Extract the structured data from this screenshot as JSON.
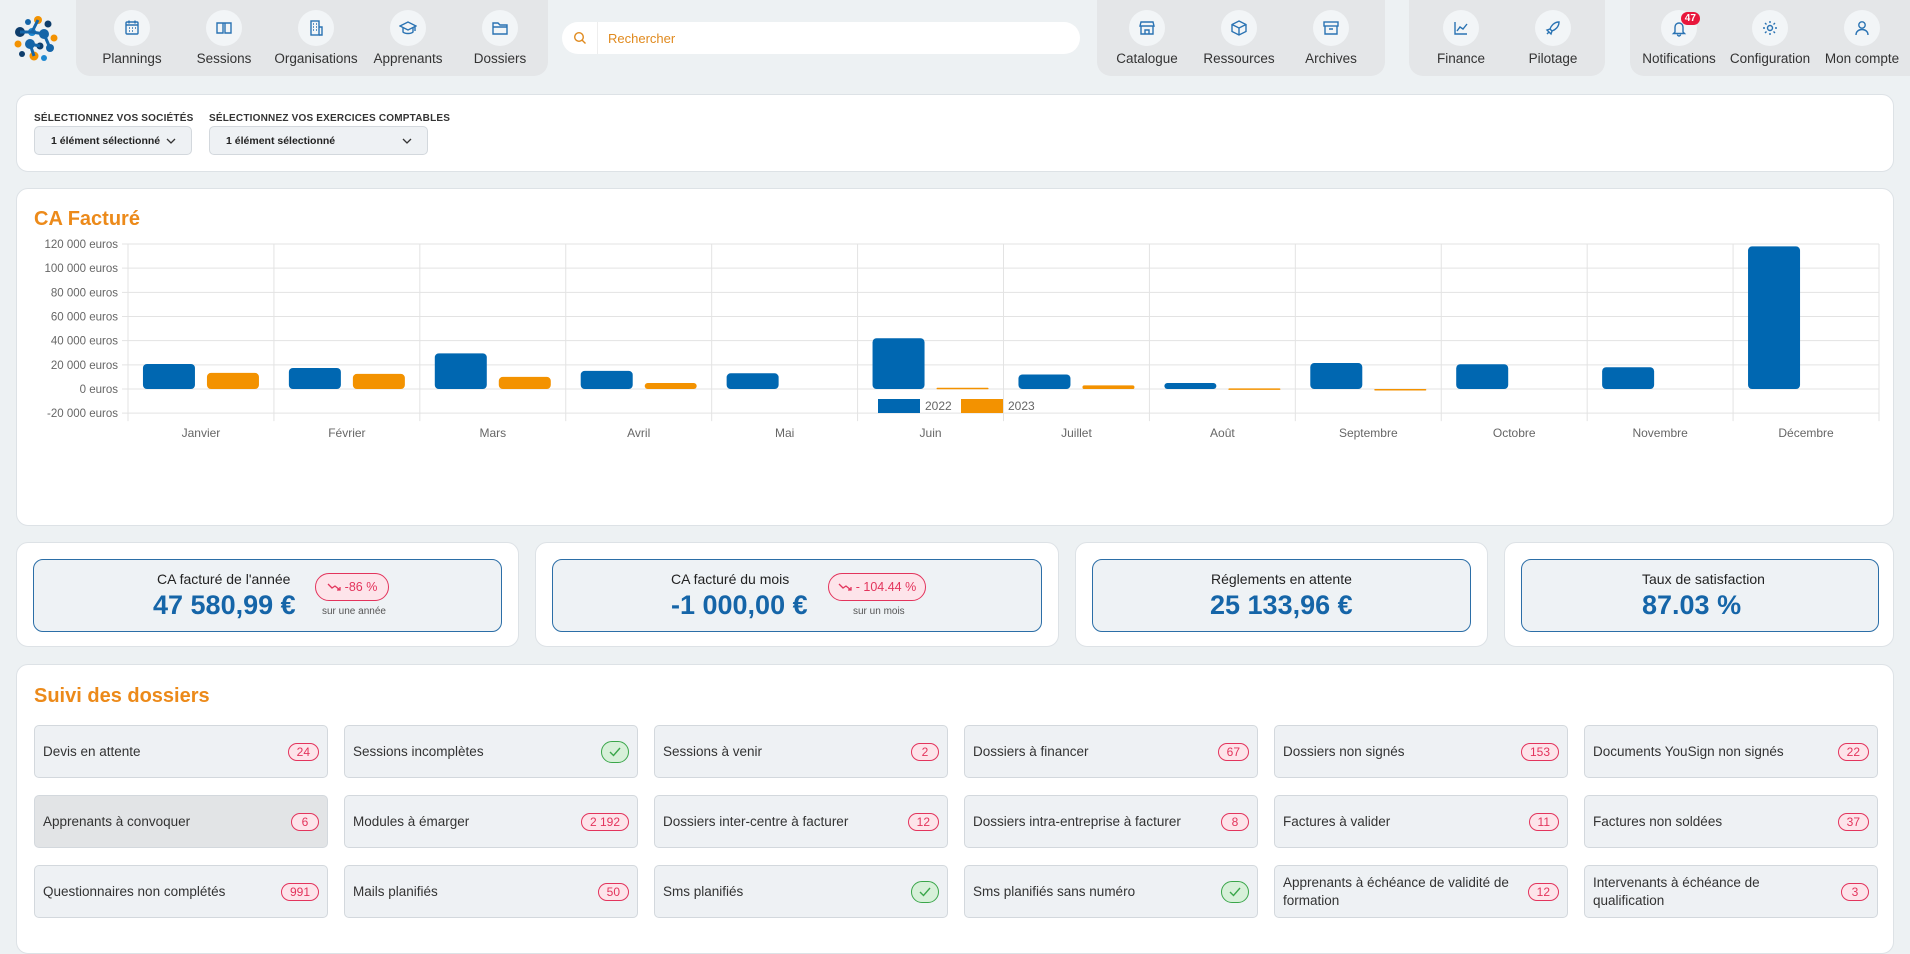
{
  "nav": {
    "group1": [
      {
        "label": "Plannings",
        "icon": "calendar-icon"
      },
      {
        "label": "Sessions",
        "icon": "book-icon"
      },
      {
        "label": "Organisations",
        "icon": "building-icon"
      },
      {
        "label": "Apprenants",
        "icon": "graduation-cap-icon"
      },
      {
        "label": "Dossiers",
        "icon": "folder-icon"
      }
    ],
    "search_placeholder": "Rechercher",
    "group2": [
      {
        "label": "Catalogue",
        "icon": "store-icon"
      },
      {
        "label": "Ressources",
        "icon": "box-icon"
      },
      {
        "label": "Archives",
        "icon": "archive-icon"
      }
    ],
    "group3": [
      {
        "label": "Finance",
        "icon": "line-chart-icon"
      },
      {
        "label": "Pilotage",
        "icon": "rocket-icon"
      }
    ],
    "group4": [
      {
        "label": "Notifications",
        "icon": "bell-icon",
        "badge": "47"
      },
      {
        "label": "Configuration",
        "icon": "gear-icon"
      },
      {
        "label": "Mon compte",
        "icon": "user-icon"
      }
    ]
  },
  "filters": {
    "societes_label": "SÉLECTIONNEZ VOS SOCIÉTÉS",
    "societes_value": "1 élément sélectionné",
    "exercices_label": "SÉLECTIONNEZ VOS EXERCICES COMPTABLES",
    "exercices_value": "1 élément sélectionné"
  },
  "chart_data": {
    "type": "bar",
    "title": "CA Facturé",
    "xlabel": "",
    "ylabel": "",
    "categories": [
      "Janvier",
      "Février",
      "Mars",
      "Avril",
      "Mai",
      "Juin",
      "Juillet",
      "Août",
      "Septembre",
      "Octobre",
      "Novembre",
      "Décembre"
    ],
    "series": [
      {
        "name": "2022",
        "color": "#0067b1",
        "values": [
          20700,
          17400,
          29500,
          15000,
          13000,
          42000,
          12000,
          5000,
          21500,
          20500,
          18000,
          118000
        ]
      },
      {
        "name": "2023",
        "color": "#f39200",
        "values": [
          13300,
          12500,
          10000,
          5000,
          0,
          1000,
          3000,
          500,
          -1000,
          0,
          0,
          0
        ]
      }
    ],
    "ylim": [
      -20000,
      120000
    ],
    "yticks": [
      "120 000 euros",
      "100 000 euros",
      "80 000 euros",
      "60 000 euros",
      "40 000 euros",
      "20 000 euros",
      "0 euros",
      "-20 000 euros"
    ],
    "ytick_values": [
      120000,
      100000,
      80000,
      60000,
      40000,
      20000,
      0,
      -20000
    ],
    "grid": true,
    "legend": "bottom"
  },
  "kpis": [
    {
      "label": "CA facturé de l'année",
      "value": "47 580,99 €",
      "trend": "-86 %",
      "trend_sub": "sur une année"
    },
    {
      "label": "CA facturé du mois",
      "value": "-1 000,00 €",
      "trend": "- 104.44 %",
      "trend_sub": "sur un mois"
    },
    {
      "label": "Réglements en attente",
      "value": "25 133,96 €"
    },
    {
      "label": "Taux de satisfaction",
      "value": "87.03 %"
    }
  ],
  "suivi": {
    "title": "Suivi des dossiers",
    "tiles": [
      {
        "label": "Devis en attente",
        "count": "24"
      },
      {
        "label": "Sessions incomplètes",
        "count": null,
        "ok": true
      },
      {
        "label": "Sessions à venir",
        "count": "2"
      },
      {
        "label": "Dossiers à financer",
        "count": "67"
      },
      {
        "label": "Dossiers non signés",
        "count": "153"
      },
      {
        "label": "Documents YouSign non signés",
        "count": "22"
      },
      {
        "label": "Apprenants à convoquer",
        "count": "6"
      },
      {
        "label": "Modules à émarger",
        "count": "2 192"
      },
      {
        "label": "Dossiers inter-centre à facturer",
        "count": "12"
      },
      {
        "label": "Dossiers intra-entreprise à facturer",
        "count": "8"
      },
      {
        "label": "Factures à valider",
        "count": "11"
      },
      {
        "label": "Factures non soldées",
        "count": "37"
      },
      {
        "label": "Questionnaires non complétés",
        "count": "991"
      },
      {
        "label": "Mails planifiés",
        "count": "50"
      },
      {
        "label": "Sms planifiés",
        "count": null,
        "ok": true
      },
      {
        "label": "Sms planifiés sans numéro",
        "count": null,
        "ok": true
      },
      {
        "label": "Apprenants à échéance de validité de formation",
        "count": "12"
      },
      {
        "label": "Intervenants à échéance de qualification",
        "count": "3"
      }
    ]
  }
}
